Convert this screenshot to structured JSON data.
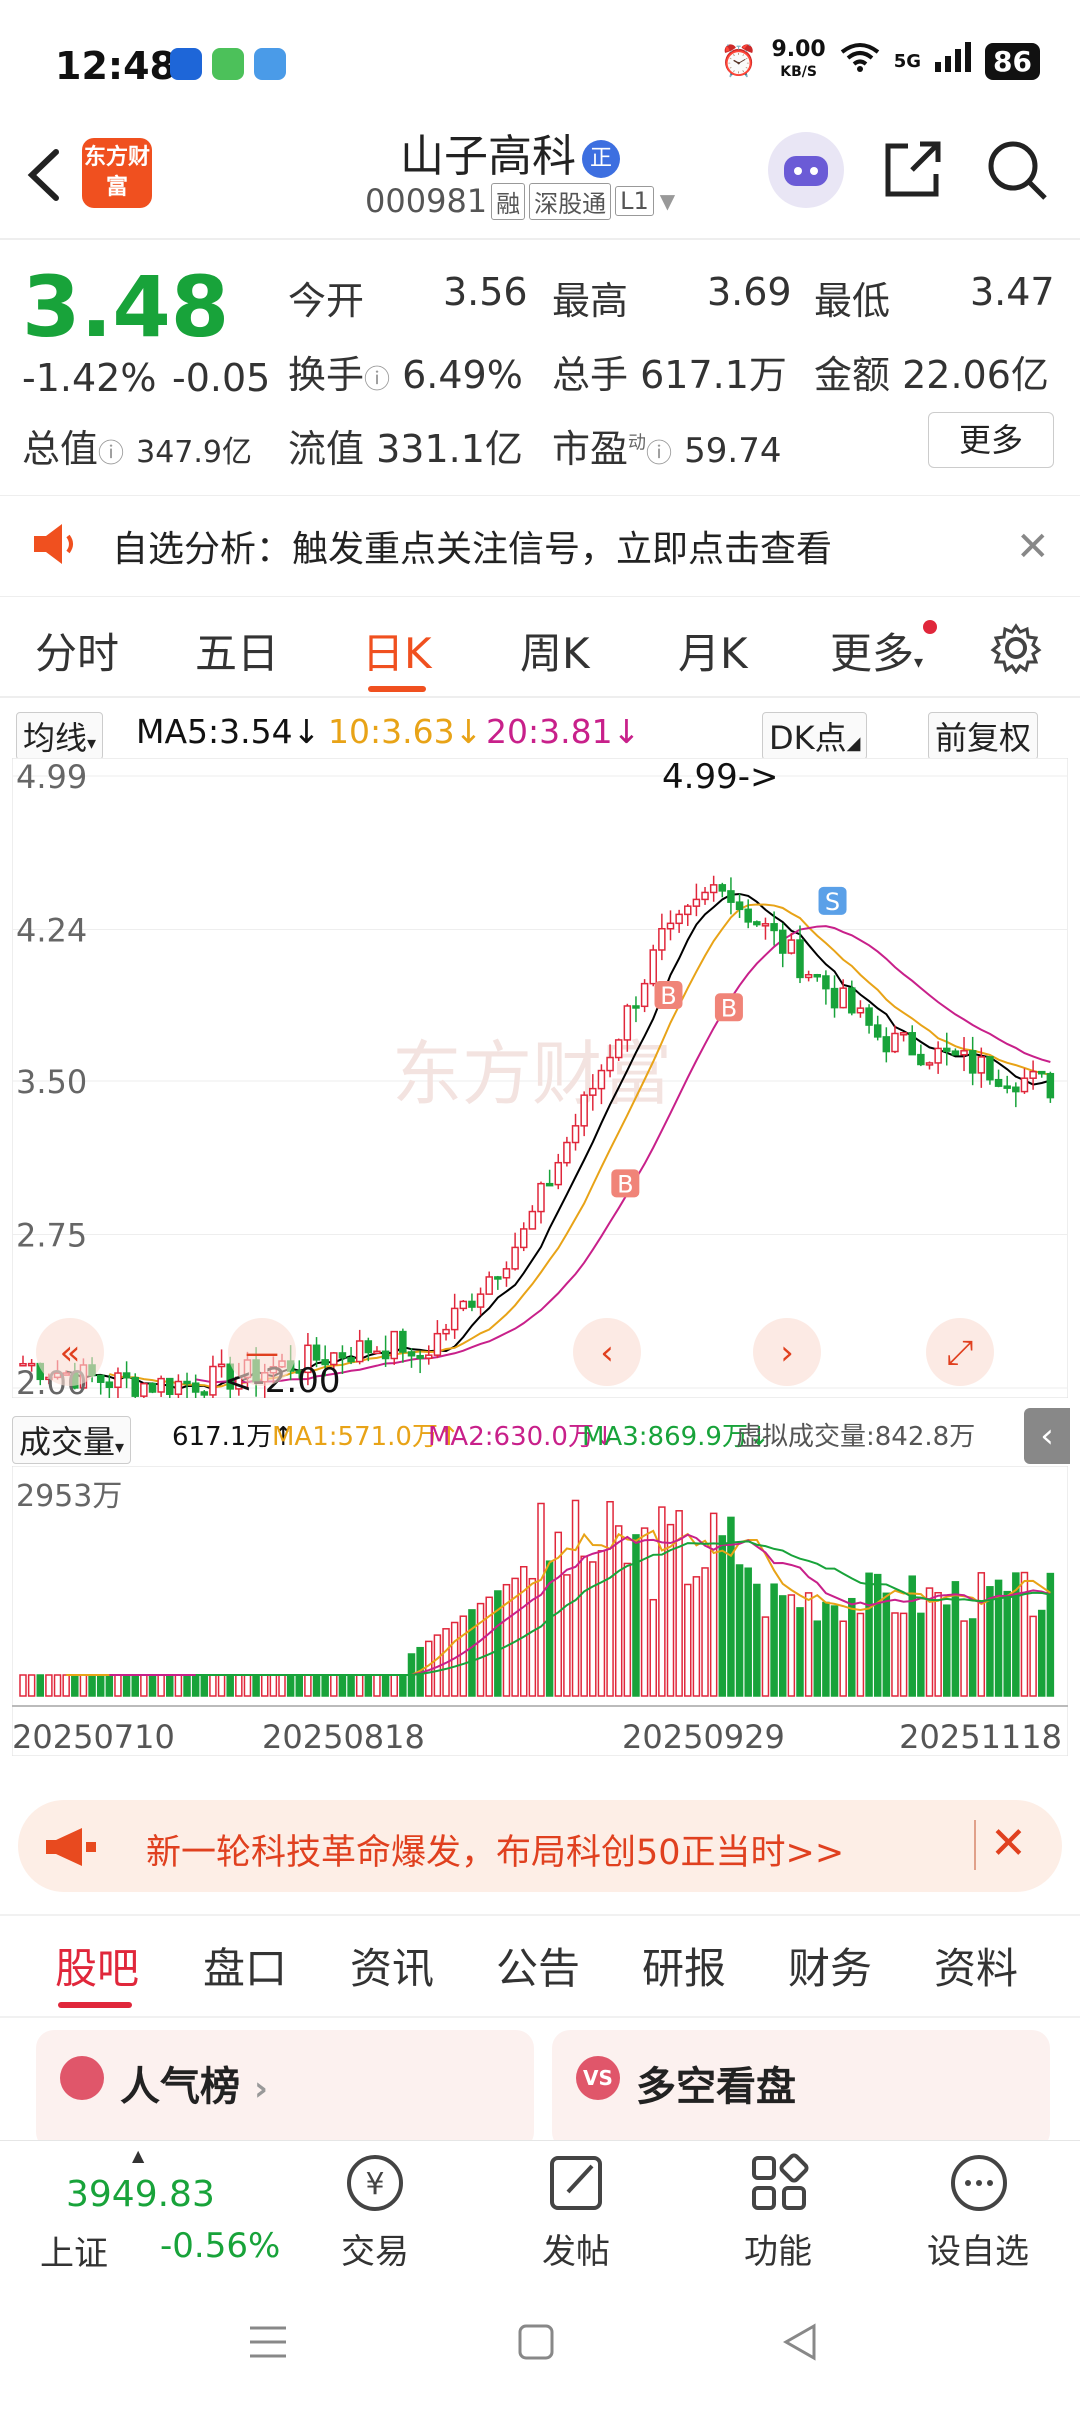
{
  "status_bar": {
    "time": "12:48",
    "net_speed": "9.00",
    "net_unit": "KB/S",
    "signal": "5G",
    "battery": "86"
  },
  "header": {
    "stock_name": "山子高科",
    "badge": "正",
    "code": "000981",
    "tags": [
      "融",
      "深股通",
      "L1"
    ],
    "logo_text": "东方财富"
  },
  "quote": {
    "price": "3.48",
    "change_pct": "-1.42%",
    "change": "-0.05",
    "open_label": "今开",
    "open": "3.56",
    "high_label": "最高",
    "high": "3.69",
    "low_label": "最低",
    "low": "3.47",
    "turnover_label": "换手",
    "turnover": "6.49%",
    "volume_label": "总手",
    "volume": "617.1万",
    "amount_label": "金额",
    "amount": "22.06亿",
    "total_cap_label": "总值",
    "total_cap": "347.9亿",
    "float_cap_label": "流值",
    "float_cap": "331.1亿",
    "pe_label": "市盈",
    "pe_sup": "动",
    "pe": "59.74",
    "more_button": "更多"
  },
  "notice": {
    "text": "自选分析：触发重点关注信号，立即点击查看"
  },
  "chart_tabs": [
    {
      "label": "分时"
    },
    {
      "label": "五日"
    },
    {
      "label": "日K"
    },
    {
      "label": "周K"
    },
    {
      "label": "月K"
    },
    {
      "label": "更多"
    }
  ],
  "ma_row": {
    "selector": "均线",
    "ma5": "MA5:3.54↓",
    "ma10": "10:3.63↓",
    "ma20": "20:3.81↓",
    "dk_button": "DK点",
    "adjust_button": "前复权"
  },
  "vol_row": {
    "selector": "成交量",
    "vol": "617.1万↑",
    "ma1": "MA1:571.0万↑",
    "ma2": "MA2:630.0万↓",
    "ma3": "MA3:869.9万↓",
    "virtual": "虚拟成交量:842.8万"
  },
  "colors": {
    "up": "#e0273b",
    "down": "#18a33a",
    "ma5": "#000000",
    "ma10": "#e8a317",
    "ma20": "#c8208a",
    "accent": "#f0501f"
  },
  "chart_data": {
    "type": "candlestick",
    "y_ticks": [
      "4.99",
      "4.24",
      "3.50",
      "2.75",
      "2.00"
    ],
    "ylim": [
      2.0,
      4.99
    ],
    "high_label": "4.99->",
    "low_label": "<-2.00",
    "markers": [
      "B",
      "B",
      "B",
      "S"
    ],
    "x_labels": [
      "20250710",
      "20250818",
      "20250929",
      "20251118"
    ],
    "vol_max_label": "2953万",
    "watermark": "东方财富"
  },
  "banner": {
    "text": "新一轮科技革命爆发，布局科创50正当时>>"
  },
  "bottom_tabs": [
    {
      "label": "股吧"
    },
    {
      "label": "盘口"
    },
    {
      "label": "资讯"
    },
    {
      "label": "公告"
    },
    {
      "label": "研报"
    },
    {
      "label": "财务"
    },
    {
      "label": "资料"
    }
  ],
  "cards": [
    {
      "title": "人气榜"
    },
    {
      "title": "多空看盘"
    }
  ],
  "index": {
    "value": "3949.83",
    "name": "上证",
    "change": "-0.56%"
  },
  "bottom_bar": [
    {
      "label": "交易"
    },
    {
      "label": "发帖"
    },
    {
      "label": "功能"
    },
    {
      "label": "设自选"
    }
  ]
}
